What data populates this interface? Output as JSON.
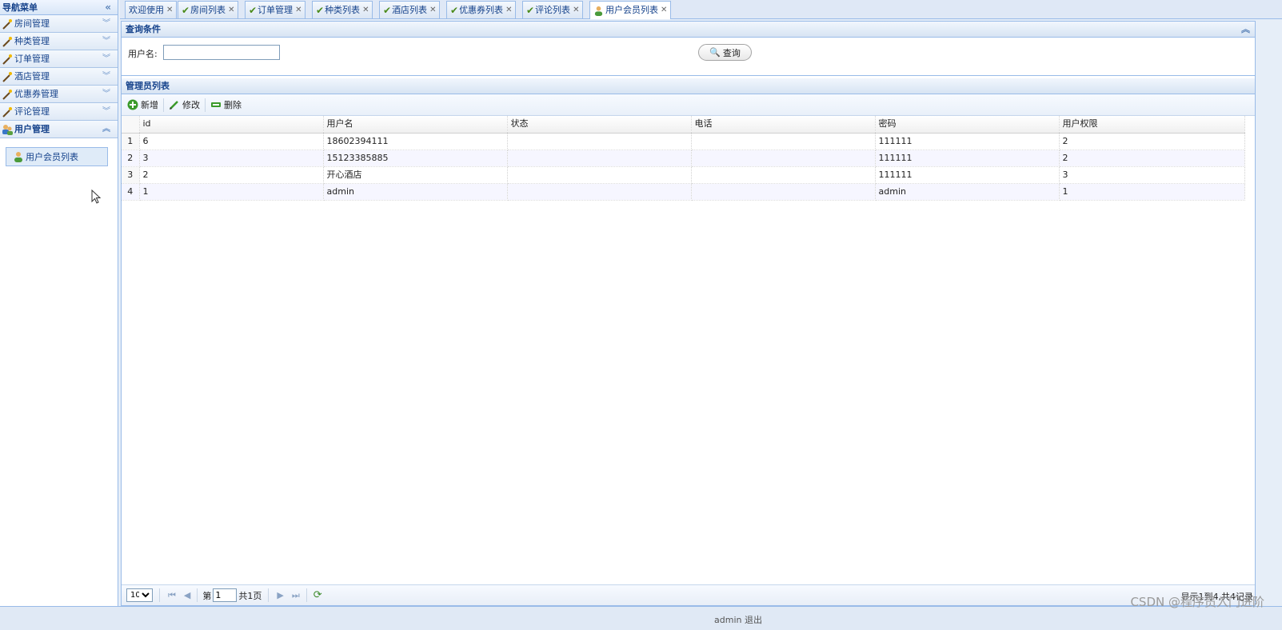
{
  "sidebar": {
    "title": "导航菜单",
    "collapse_icon": "double-chevron-left-icon",
    "items": [
      {
        "label": "房间管理"
      },
      {
        "label": "种类管理"
      },
      {
        "label": "订单管理"
      },
      {
        "label": "酒店管理"
      },
      {
        "label": "优惠券管理"
      },
      {
        "label": "评论管理"
      },
      {
        "label": "用户管理"
      }
    ],
    "sub_item": "用户会员列表"
  },
  "tabs": [
    {
      "label": "欢迎使用"
    },
    {
      "label": "房间列表"
    },
    {
      "label": "订单管理"
    },
    {
      "label": "种类列表"
    },
    {
      "label": "酒店列表"
    },
    {
      "label": "优惠券列表"
    },
    {
      "label": "评论列表"
    },
    {
      "label": "用户会员列表"
    }
  ],
  "query": {
    "title": "查询条件",
    "username_label": "用户名:",
    "username_value": "",
    "search_button": "查询"
  },
  "list": {
    "title": "管理员列表",
    "toolbar": {
      "add": "新增",
      "edit": "修改",
      "delete": "删除"
    },
    "columns": [
      "id",
      "用户名",
      "状态",
      "电话",
      "密码",
      "用户权限"
    ],
    "rows": [
      {
        "n": "1",
        "id": "6",
        "username": "18602394111",
        "status": "",
        "phone": "",
        "password": "111111",
        "perm": "2"
      },
      {
        "n": "2",
        "id": "3",
        "username": "15123385885",
        "status": "",
        "phone": "",
        "password": "111111",
        "perm": "2"
      },
      {
        "n": "3",
        "id": "2",
        "username": "开心酒店",
        "status": "",
        "phone": "",
        "password": "111111",
        "perm": "3"
      },
      {
        "n": "4",
        "id": "1",
        "username": "admin",
        "status": "",
        "phone": "",
        "password": "admin",
        "perm": "1"
      }
    ]
  },
  "pager": {
    "page_size": "10",
    "page_prefix": "第",
    "page_value": "1",
    "page_total": "共1页",
    "info": "显示1到4,共4记录"
  },
  "footer": {
    "user_text": "admin    退出"
  },
  "watermark": "CSDN @程序员入门进阶",
  "colors": {
    "accent": "#15428b",
    "border": "#99bbe8"
  }
}
